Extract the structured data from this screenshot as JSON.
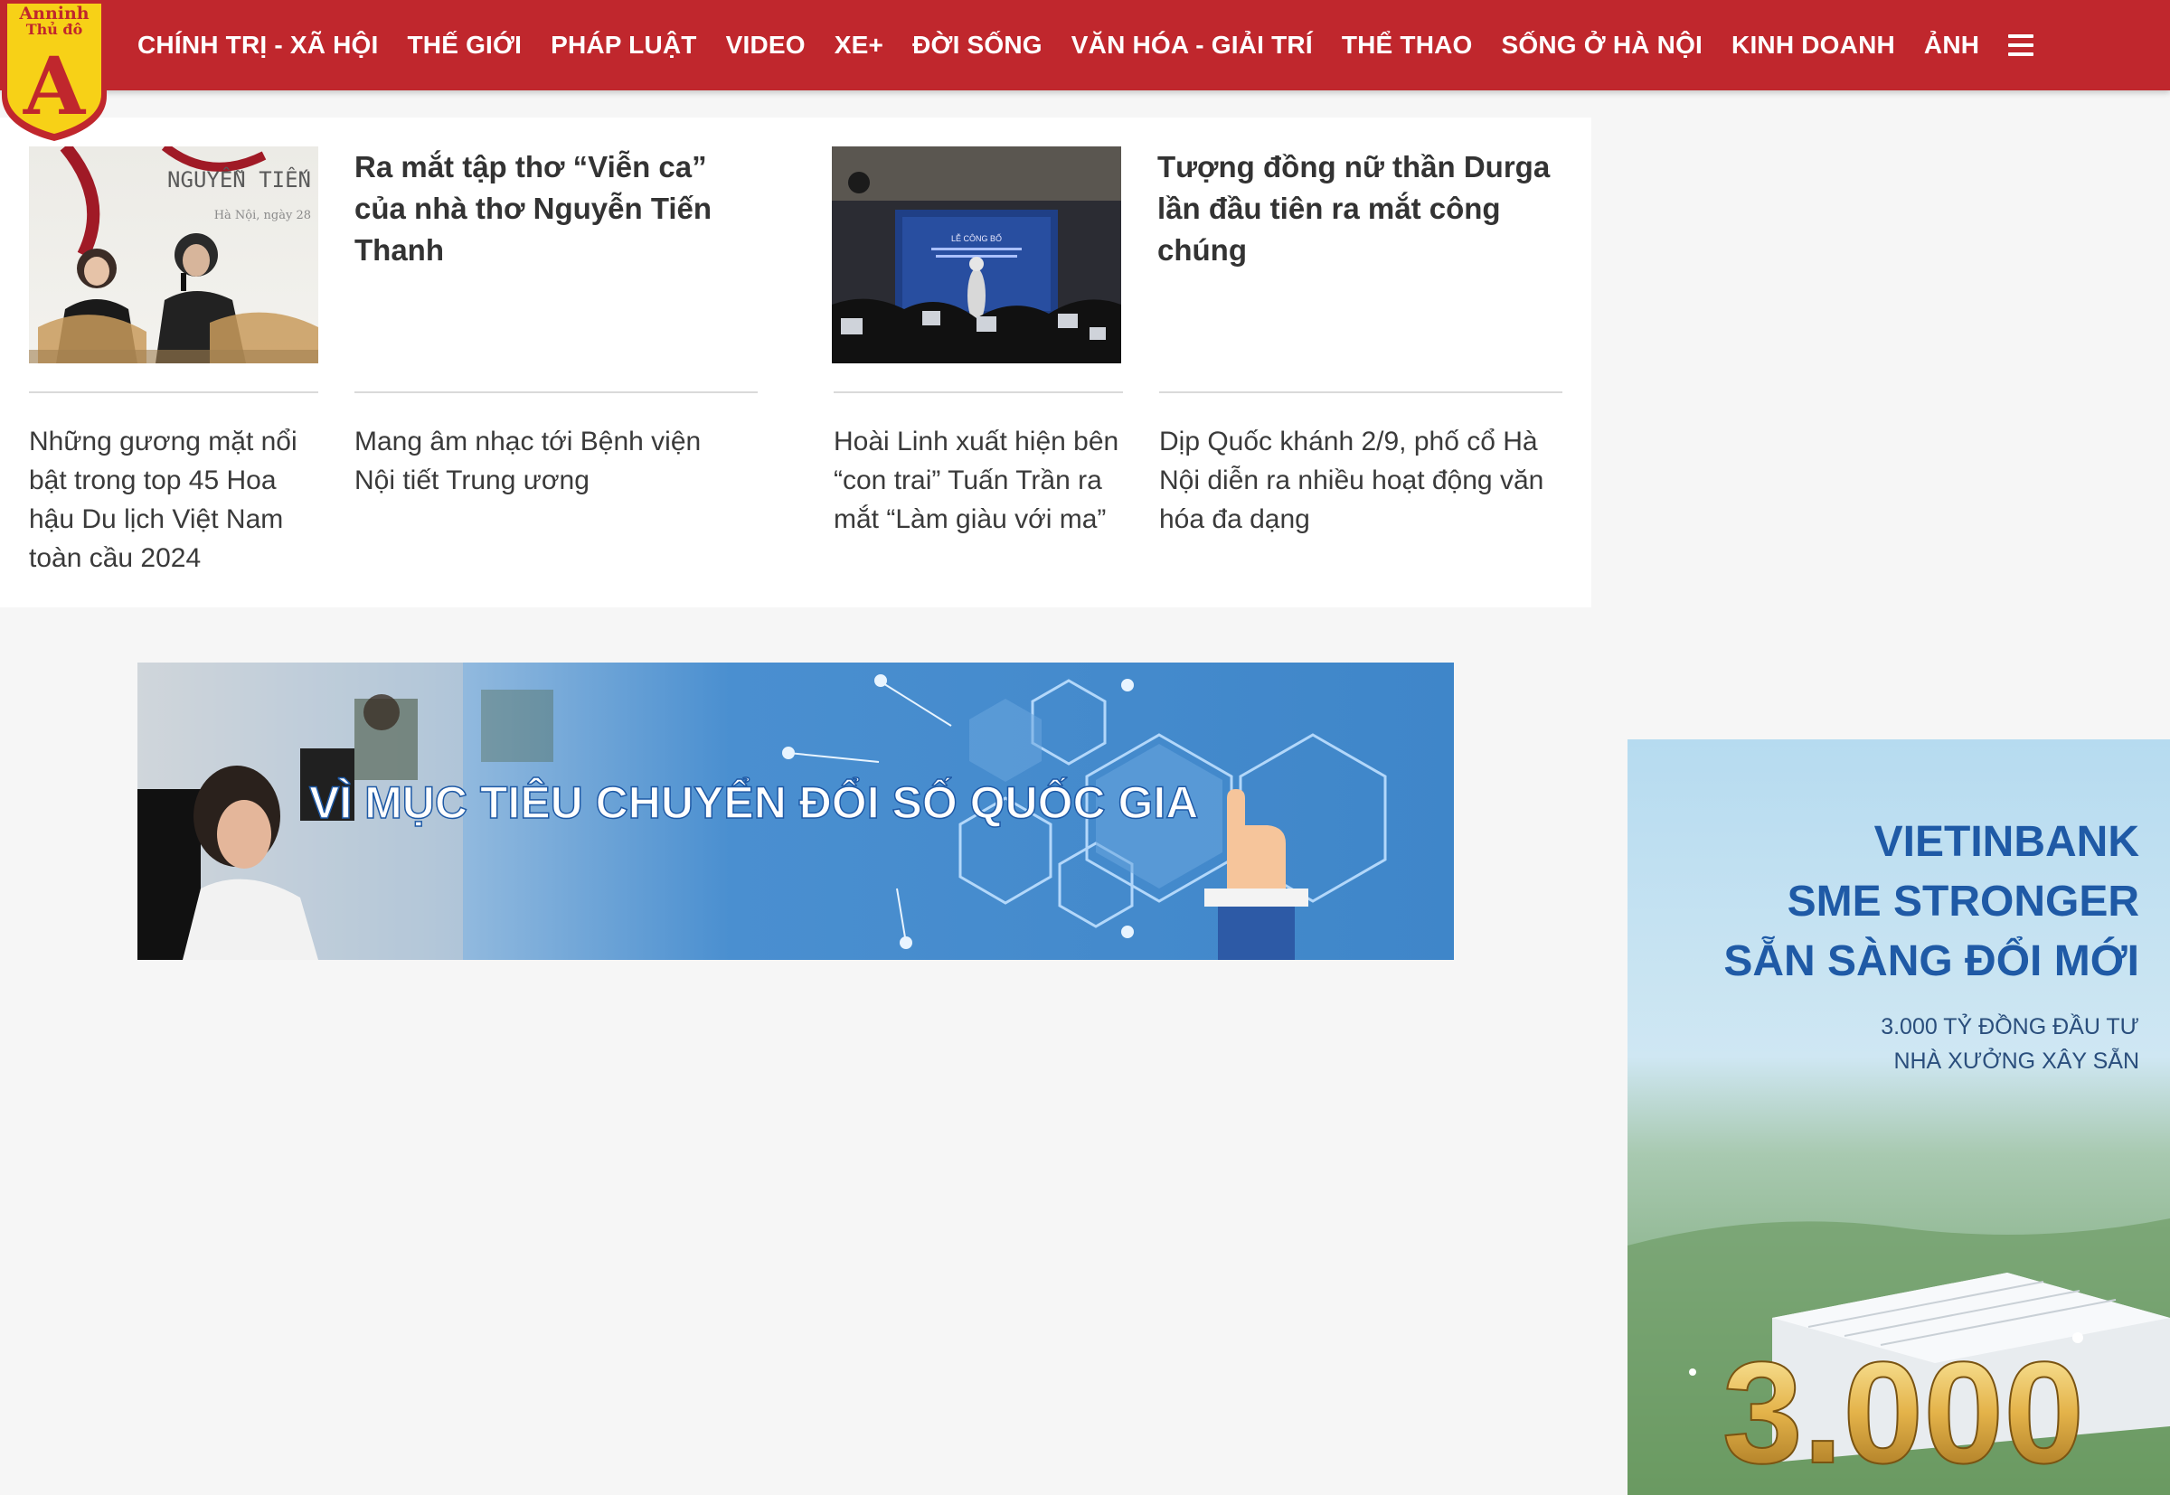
{
  "logo": {
    "line1": "Anninh",
    "line2": "Thủ đô",
    "letter": "A",
    "colors": {
      "red": "#c0272d",
      "yellow": "#f7d117"
    }
  },
  "nav": {
    "items": [
      "CHÍNH TRỊ - XÃ HỘI",
      "THẾ GIỚI",
      "PHÁP LUẬT",
      "VIDEO",
      "XE+",
      "ĐỜI SỐNG",
      "VĂN HÓA - GIẢI TRÍ",
      "THỂ THAO",
      "SỐNG Ở HÀ NỘI",
      "KINH DOANH",
      "ẢNH"
    ],
    "menu_icon": "hamburger-menu-icon"
  },
  "related": {
    "featured": [
      {
        "title": "Ra mắt tập thơ “Viễn ca” của nhà thơ Nguyễn Tiến Thanh",
        "thumb_caption": "NGUYỄN TIẾN",
        "thumb_date": "Hà Nội, ngày 28"
      },
      {
        "title": "Tượng đồng nữ thần Durga lần đầu tiên ra mắt công chúng",
        "thumb_caption": "LỄ CÔNG BỐ"
      }
    ],
    "items": [
      "Những gương mặt nổi bật trong top 45 Hoa hậu Du lịch Việt Nam toàn cầu 2024",
      "Mang âm nhạc tới Bệnh viện Nội tiết Trung ương",
      "Hoài Linh xuất hiện bên “con trai” Tuấn Trần ra mắt “Làm giàu với ma”",
      "Dịp Quốc khánh 2/9, phố cổ Hà Nội diễn ra nhiều hoạt động văn hóa đa dạng"
    ]
  },
  "banner_wide": {
    "text": "VÌ MỤC TIÊU CHUYỂN ĐỔI SỐ QUỐC GIA",
    "accent": "#4a8fd0"
  },
  "banner_side": {
    "line1": "VIETINBANK",
    "line2": "SME STRONGER",
    "line3": "SẴN SÀNG ĐỔI MỚI",
    "sub1": "3.000 TỶ ĐỒNG ĐẦU TƯ",
    "sub2": "NHÀ XƯỞNG XÂY SẴN",
    "big_number": "3.000",
    "accent": "#1f5aa6"
  }
}
